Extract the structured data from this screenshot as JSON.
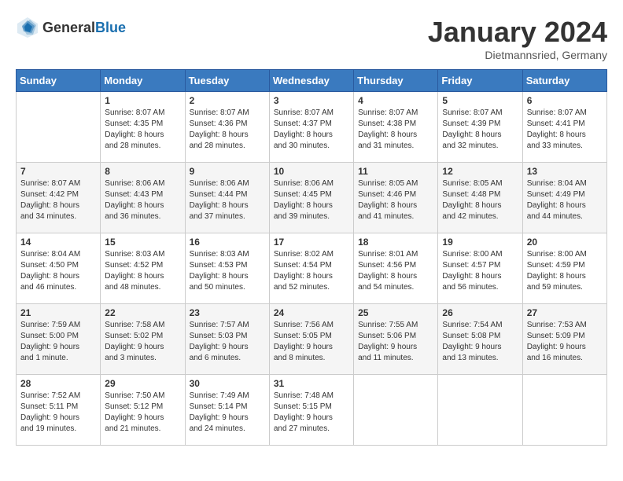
{
  "header": {
    "logo_general": "General",
    "logo_blue": "Blue",
    "month_title": "January 2024",
    "location": "Dietmannsried, Germany"
  },
  "days_of_week": [
    "Sunday",
    "Monday",
    "Tuesday",
    "Wednesday",
    "Thursday",
    "Friday",
    "Saturday"
  ],
  "weeks": [
    [
      {
        "day": "",
        "info": ""
      },
      {
        "day": "1",
        "info": "Sunrise: 8:07 AM\nSunset: 4:35 PM\nDaylight: 8 hours\nand 28 minutes."
      },
      {
        "day": "2",
        "info": "Sunrise: 8:07 AM\nSunset: 4:36 PM\nDaylight: 8 hours\nand 28 minutes."
      },
      {
        "day": "3",
        "info": "Sunrise: 8:07 AM\nSunset: 4:37 PM\nDaylight: 8 hours\nand 30 minutes."
      },
      {
        "day": "4",
        "info": "Sunrise: 8:07 AM\nSunset: 4:38 PM\nDaylight: 8 hours\nand 31 minutes."
      },
      {
        "day": "5",
        "info": "Sunrise: 8:07 AM\nSunset: 4:39 PM\nDaylight: 8 hours\nand 32 minutes."
      },
      {
        "day": "6",
        "info": "Sunrise: 8:07 AM\nSunset: 4:41 PM\nDaylight: 8 hours\nand 33 minutes."
      }
    ],
    [
      {
        "day": "7",
        "info": ""
      },
      {
        "day": "8",
        "info": "Sunrise: 8:06 AM\nSunset: 4:43 PM\nDaylight: 8 hours\nand 36 minutes."
      },
      {
        "day": "9",
        "info": "Sunrise: 8:06 AM\nSunset: 4:44 PM\nDaylight: 8 hours\nand 37 minutes."
      },
      {
        "day": "10",
        "info": "Sunrise: 8:06 AM\nSunset: 4:45 PM\nDaylight: 8 hours\nand 39 minutes."
      },
      {
        "day": "11",
        "info": "Sunrise: 8:05 AM\nSunset: 4:46 PM\nDaylight: 8 hours\nand 41 minutes."
      },
      {
        "day": "12",
        "info": "Sunrise: 8:05 AM\nSunset: 4:48 PM\nDaylight: 8 hours\nand 42 minutes."
      },
      {
        "day": "13",
        "info": "Sunrise: 8:04 AM\nSunset: 4:49 PM\nDaylight: 8 hours\nand 44 minutes."
      }
    ],
    [
      {
        "day": "14",
        "info": ""
      },
      {
        "day": "15",
        "info": "Sunrise: 8:03 AM\nSunset: 4:52 PM\nDaylight: 8 hours\nand 48 minutes."
      },
      {
        "day": "16",
        "info": "Sunrise: 8:03 AM\nSunset: 4:53 PM\nDaylight: 8 hours\nand 50 minutes."
      },
      {
        "day": "17",
        "info": "Sunrise: 8:02 AM\nSunset: 4:54 PM\nDaylight: 8 hours\nand 52 minutes."
      },
      {
        "day": "18",
        "info": "Sunrise: 8:01 AM\nSunset: 4:56 PM\nDaylight: 8 hours\nand 54 minutes."
      },
      {
        "day": "19",
        "info": "Sunrise: 8:00 AM\nSunset: 4:57 PM\nDaylight: 8 hours\nand 56 minutes."
      },
      {
        "day": "20",
        "info": "Sunrise: 8:00 AM\nSunset: 4:59 PM\nDaylight: 8 hours\nand 59 minutes."
      }
    ],
    [
      {
        "day": "21",
        "info": ""
      },
      {
        "day": "22",
        "info": "Sunrise: 7:58 AM\nSunset: 5:02 PM\nDaylight: 9 hours\nand 3 minutes."
      },
      {
        "day": "23",
        "info": "Sunrise: 7:57 AM\nSunset: 5:03 PM\nDaylight: 9 hours\nand 6 minutes."
      },
      {
        "day": "24",
        "info": "Sunrise: 7:56 AM\nSunset: 5:05 PM\nDaylight: 9 hours\nand 8 minutes."
      },
      {
        "day": "25",
        "info": "Sunrise: 7:55 AM\nSunset: 5:06 PM\nDaylight: 9 hours\nand 11 minutes."
      },
      {
        "day": "26",
        "info": "Sunrise: 7:54 AM\nSunset: 5:08 PM\nDaylight: 9 hours\nand 13 minutes."
      },
      {
        "day": "27",
        "info": "Sunrise: 7:53 AM\nSunset: 5:09 PM\nDaylight: 9 hours\nand 16 minutes."
      }
    ],
    [
      {
        "day": "28",
        "info": ""
      },
      {
        "day": "29",
        "info": "Sunrise: 7:50 AM\nSunset: 5:12 PM\nDaylight: 9 hours\nand 21 minutes."
      },
      {
        "day": "30",
        "info": "Sunrise: 7:49 AM\nSunset: 5:14 PM\nDaylight: 9 hours\nand 24 minutes."
      },
      {
        "day": "31",
        "info": "Sunrise: 7:48 AM\nSunset: 5:15 PM\nDaylight: 9 hours\nand 27 minutes."
      },
      {
        "day": "",
        "info": ""
      },
      {
        "day": "",
        "info": ""
      },
      {
        "day": "",
        "info": ""
      }
    ]
  ],
  "week1_sunday": "Sunrise: 8:07 AM\nSunset: 4:42 PM\nDaylight: 8 hours\nand 34 minutes.",
  "week2_sunday": "Sunrise: 8:07 AM\nSunset: 4:42 PM\nDaylight: 8 hours\nand 34 minutes.",
  "week3_sunday": "Sunrise: 8:04 AM\nSunset: 4:50 PM\nDaylight: 8 hours\nand 46 minutes.",
  "week4_sunday": "Sunrise: 7:59 AM\nSunset: 5:00 PM\nDaylight: 9 hours\nand 1 minute.",
  "week5_sunday": "Sunrise: 7:52 AM\nSunset: 5:11 PM\nDaylight: 9 hours\nand 19 minutes."
}
